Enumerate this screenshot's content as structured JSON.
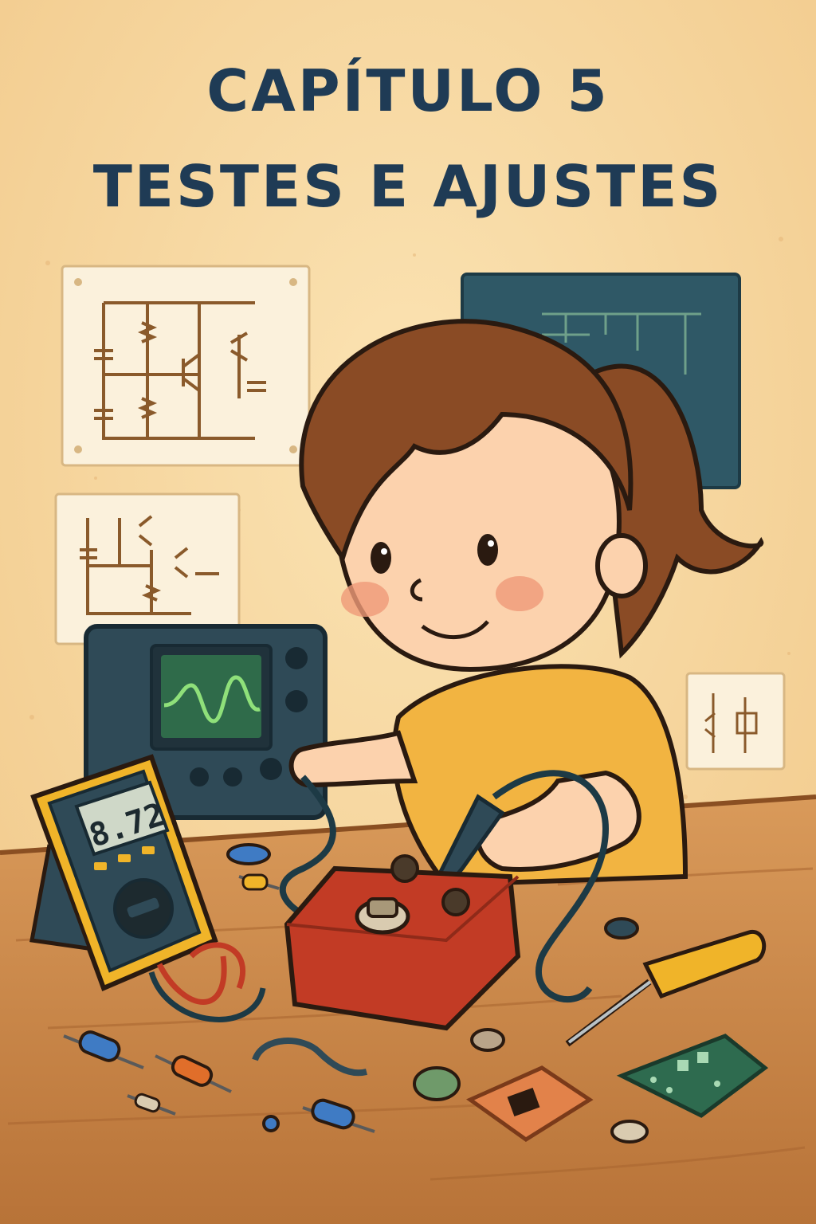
{
  "cover": {
    "title_line_1": "CAPÍTULO 5",
    "title_line_2": "TESTES E AJUSTES"
  },
  "multimeter": {
    "reading": "8.72"
  },
  "colors": {
    "background": "#f7d8a0",
    "title": "#1f3b55",
    "desk": "#c98a4b",
    "shirt": "#f2b441",
    "hair": "#8a4b25",
    "pedal": "#c23b25",
    "multimeter_body": "#f0b429",
    "oscilloscope": "#2f4a57",
    "waveform": "#8fe07a"
  },
  "icons": {
    "schematic_1": "circuit-schematic",
    "schematic_2": "circuit-schematic",
    "blueprint": "pcb-blueprint",
    "note": "circuit-note"
  }
}
